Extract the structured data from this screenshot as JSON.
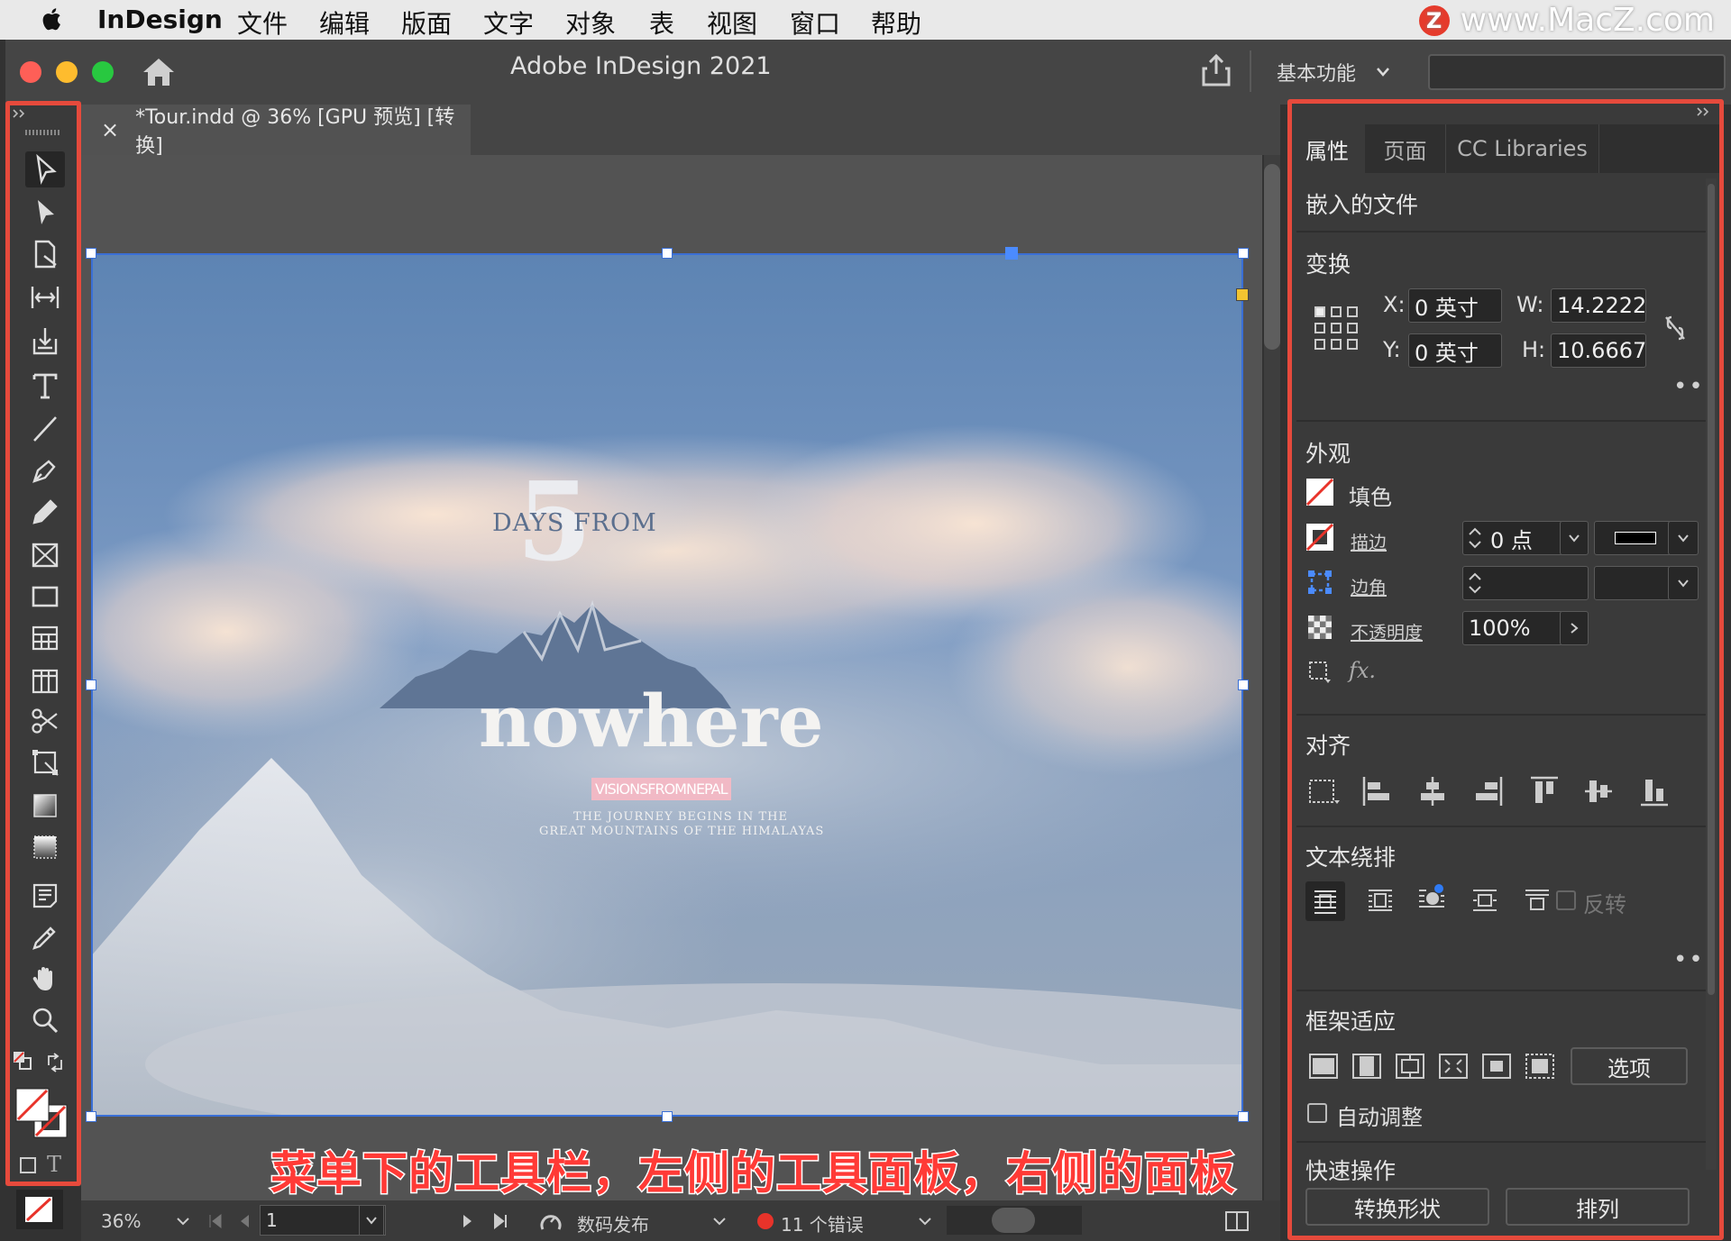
{
  "menubar": {
    "app": "InDesign",
    "items": [
      "文件",
      "编辑",
      "版面",
      "文字",
      "对象",
      "表",
      "视图",
      "窗口",
      "帮助"
    ],
    "watermark": "www.MacZ.com",
    "watermark_logo": "Z"
  },
  "titlebar": {
    "title": "Adobe InDesign 2021",
    "workspace": "基本功能"
  },
  "document_tab": {
    "close": "×",
    "title": "*Tour.indd @ 36% [GPU 预览] [转换]"
  },
  "artwork": {
    "number": "5",
    "days_from": "DAYS FROM",
    "nowhere": "nowhere",
    "visions": "VISIONSFROMNEPAL",
    "tagline1": "THE JOURNEY BEGINS IN THE",
    "tagline2": "GREAT MOUNTAINS OF THE HIMALAYAS"
  },
  "caption": "菜单下的工具栏，左侧的工具面板，右侧的面板",
  "statusbar": {
    "zoom": "36%",
    "page": "1",
    "publish": "数码发布",
    "errors": "11 个错误"
  },
  "panel": {
    "tabs": [
      "属性",
      "页面",
      "CC Libraries"
    ],
    "embedded": "嵌入的文件",
    "transform": {
      "title": "变换",
      "x_label": "X:",
      "x_value": "0 英寸",
      "y_label": "Y:",
      "y_value": "0 英寸",
      "w_label": "W:",
      "w_value": "14.2222",
      "h_label": "H:",
      "h_value": "10.6667"
    },
    "appearance": {
      "title": "外观",
      "fill": "填色",
      "stroke": "描边",
      "stroke_value": "0 点",
      "corner": "边角",
      "opacity": "不透明度",
      "opacity_value": "100%",
      "fx": "fx."
    },
    "align": {
      "title": "对齐"
    },
    "text_wrap": {
      "title": "文本绕排",
      "invert": "反转"
    },
    "frame_fit": {
      "title": "框架适应",
      "options": "选项",
      "auto_fit": "自动调整"
    },
    "quick_actions": {
      "title": "快速操作",
      "convert_shape": "转换形状",
      "arrange": "排列"
    }
  },
  "colors": {
    "highlight_frame": "#e64a3c",
    "selection": "#3a6fd6",
    "caption": "#ff3a36",
    "error_dot": "#e8332a"
  }
}
